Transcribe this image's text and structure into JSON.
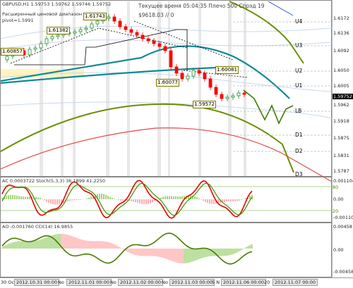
{
  "main_pane": {
    "symbol_line": "GBPUSD,H1  1.59753 1.59762 1.59746 1.59752",
    "pivot_note_line1": "Расширенный ценовой диапазон",
    "pivot_note_line2": "pivot=1.5991",
    "info_line1": "Текущее время 05:04:35 Плечо 500 Спрэд 19",
    "info_line2": "$9618.03       // 0",
    "level_labels": [
      "U4",
      "U3",
      "U2",
      "U1",
      "LB",
      "D1",
      "D2",
      "D3"
    ],
    "price_marks": [
      "1.61743",
      "1.61382",
      "1.60857",
      "1.60077",
      "1.60081",
      "1.59572"
    ],
    "price_axis": [
      "1.6172",
      "1.6136",
      "1.6092",
      "1.6050",
      "1.6005",
      "1.5962",
      "1.5918",
      "1.5875",
      "1.5831",
      "1.5787"
    ],
    "current_price": "1.59752"
  },
  "ac_pane": {
    "label": "AC 0.0003722  Stoch(5,3,3) 36.1899 41.2250",
    "levels": [
      "80",
      "20"
    ],
    "axis": [
      "0.0011045",
      "0.00",
      "-0.0011045"
    ]
  },
  "ao_pane": {
    "label": "AO -0.001760  CCI(14) 16.9855",
    "axis": [
      "0.00458",
      "0.00",
      "-0.00458"
    ]
  },
  "time_axis": {
    "labels": [
      "30 Oct",
      "2012.10.31 00:00",
      "No",
      "2012.11.01 00:00",
      "No",
      "2012.11.02 00:00",
      "No",
      "2012.11.03 00:00",
      "5 N",
      "2012.11.06 00:00",
      "20",
      "2012.11.07 00:00"
    ]
  },
  "colors": {
    "candle_up": "#1e8f2f",
    "candle_down": "#ff0000",
    "ma_teal": "#0e8a93",
    "ma_olive": "#6b8e00",
    "ma_red": "#e34a4a",
    "stoch_red": "#e60000",
    "stoch_green": "#4b8b00",
    "cci_green": "#4b7a00"
  }
}
